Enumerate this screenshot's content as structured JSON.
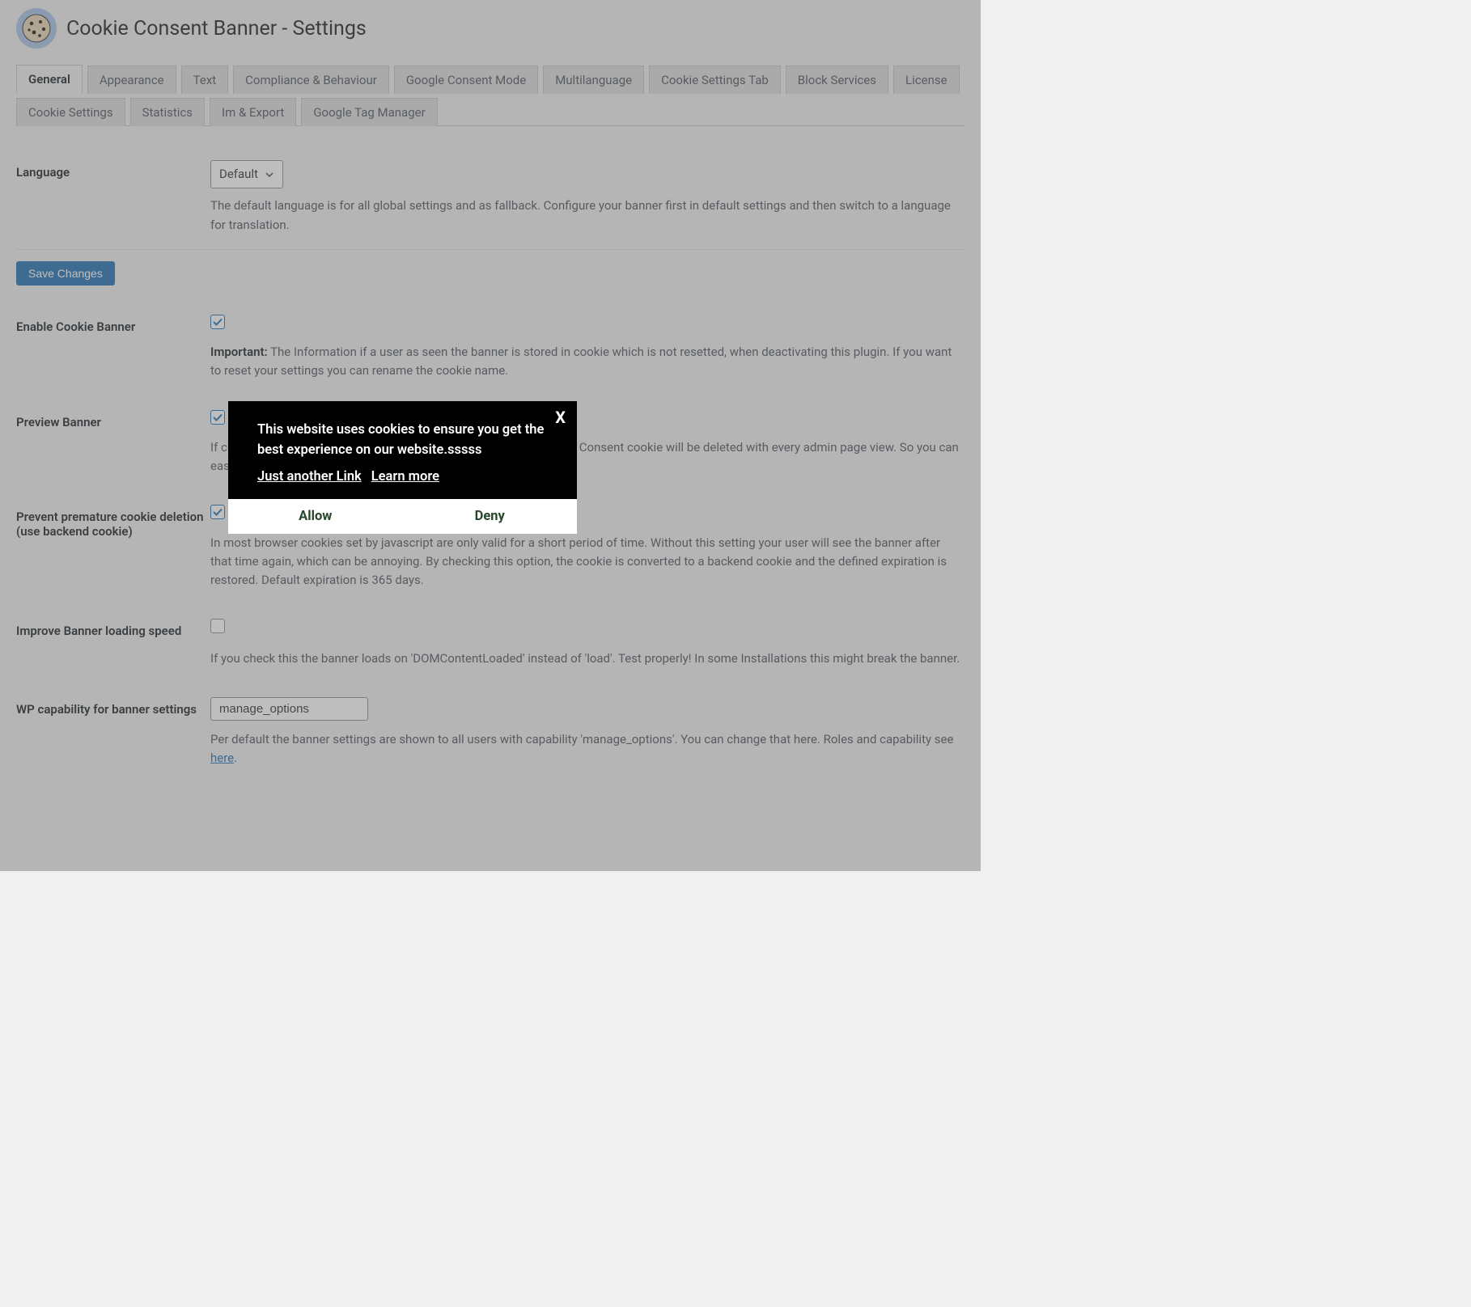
{
  "header": {
    "title": "Cookie Consent Banner - Settings"
  },
  "tabs": [
    {
      "label": "General",
      "active": true
    },
    {
      "label": "Appearance"
    },
    {
      "label": "Text"
    },
    {
      "label": "Compliance & Behaviour"
    },
    {
      "label": "Google Consent Mode"
    },
    {
      "label": "Multilanguage"
    },
    {
      "label": "Cookie Settings Tab"
    },
    {
      "label": "Block Services"
    },
    {
      "label": "License"
    },
    {
      "label": "Cookie Settings"
    },
    {
      "label": "Statistics"
    },
    {
      "label": "Im & Export"
    },
    {
      "label": "Google Tag Manager"
    }
  ],
  "save_label": "Save Changes",
  "language": {
    "label": "Language",
    "selected": "Default",
    "desc": "The default language is for all global settings and as fallback. Configure your banner first in default settings and then switch to a language for translation."
  },
  "enable": {
    "label": "Enable Cookie Banner",
    "checked": true,
    "important": "Important:",
    "desc": " The Information if a user as seen the banner is stored in cookie which is not resetted, when deactivating this plugin. If you want to reset your settings you can rename the cookie name."
  },
  "preview": {
    "label": "Preview Banner",
    "checked": true,
    "desc": "If checked the cookie banner is shown permanently only for admins. Consent cookie will be deleted with every admin page view. So you can easily style your banner."
  },
  "prevent": {
    "label": "Prevent premature cookie deletion (use backend cookie)",
    "checked": true,
    "desc": "In most browser cookies set by javascript are only valid for a short period of time. Without this setting your user will see the banner after that time again, which can be annoying. By checking this option, the cookie is converted to a backend cookie and the defined expiration is restored. Default expiration is 365 days."
  },
  "improve": {
    "label": "Improve Banner loading speed",
    "checked": false,
    "desc": "If you check this the banner loads on 'DOMContentLoaded' instead of 'load'. Test properly! In some Installations this might break the banner."
  },
  "capability": {
    "label": "WP capability for banner settings",
    "value": "manage_options",
    "desc_pre": "Per default the banner settings are shown to all users with capability 'manage_options'. You can change that here. Roles and capability see ",
    "link": "here",
    "desc_post": "."
  },
  "banner": {
    "close": "X",
    "text": "This website uses cookies to ensure you get the best experience on our website.sssss",
    "link1": "Just another Link",
    "link2": "Learn more",
    "allow": "Allow",
    "deny": "Deny"
  }
}
